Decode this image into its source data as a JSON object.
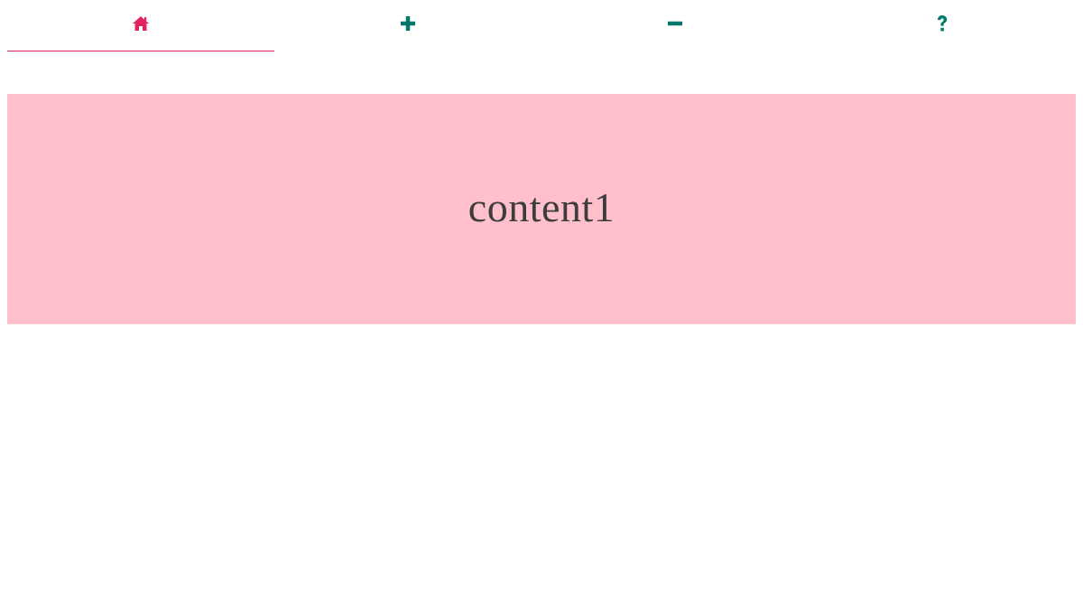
{
  "tabs": [
    {
      "icon": "home-icon",
      "label": "",
      "active": true,
      "color": "#e0245e"
    },
    {
      "icon": "plus-icon",
      "label": "",
      "active": false,
      "color": "#00796b"
    },
    {
      "icon": "minus-icon",
      "label": "",
      "active": false,
      "color": "#00796b"
    },
    {
      "icon": "question-icon",
      "label": "",
      "active": false,
      "color": "#00796b"
    }
  ],
  "colors": {
    "active_tab": "#e0245e",
    "inactive_tab": "#00796b",
    "indicator": "#e0245e",
    "panel_background": "#ffc0cb",
    "panel_text": "#3d3d3d"
  },
  "content": {
    "text": "content1"
  }
}
